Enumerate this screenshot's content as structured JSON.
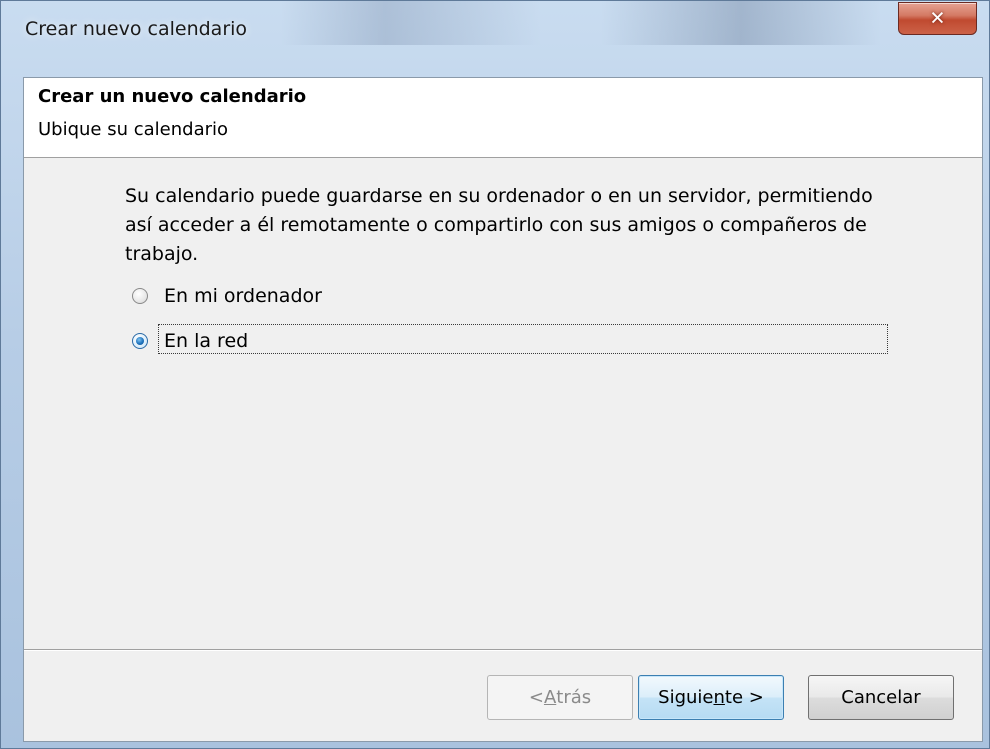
{
  "window": {
    "title": "Crear nuevo calendario"
  },
  "header": {
    "title": "Crear un nuevo calendario",
    "subtitle": "Ubique su calendario"
  },
  "content": {
    "description": "Su calendario puede guardarse en su ordenador o en un servidor, permitiendo así acceder a él remotamente o compartirlo con sus amigos o compañeros de trabajo.",
    "options": [
      {
        "label": "En mi ordenador",
        "selected": false
      },
      {
        "label": "En la red",
        "selected": true
      }
    ]
  },
  "buttons": {
    "back": {
      "prefix": "< ",
      "mnemonic": "A",
      "rest": "trás",
      "enabled": false
    },
    "next": {
      "prefix": "Siguie",
      "mnemonic": "n",
      "rest": "te >"
    },
    "cancel": {
      "label": "Cancelar"
    }
  },
  "icons": {
    "close": "close-icon",
    "radio": "radio-button-icon"
  },
  "colors": {
    "accent": "#1e73be",
    "close_button": "#c04a30",
    "dialog_background": "#f0f0f0"
  }
}
